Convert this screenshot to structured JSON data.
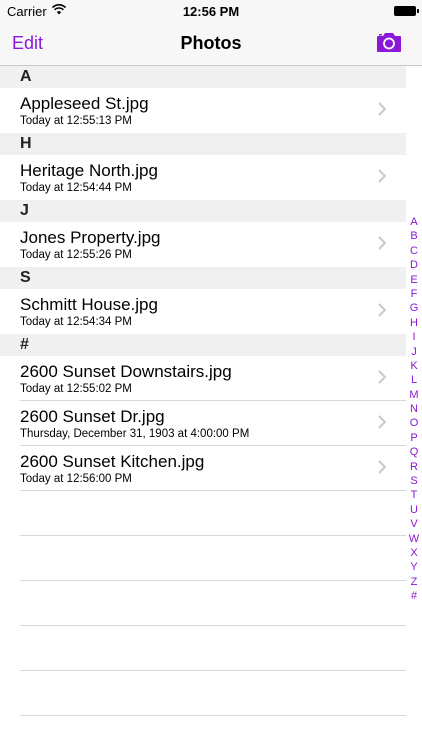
{
  "status_bar": {
    "carrier": "Carrier",
    "time": "12:56 PM"
  },
  "nav": {
    "edit_label": "Edit",
    "title": "Photos",
    "camera_icon": "camera-icon",
    "accent_color": "#8a18d6"
  },
  "sections": [
    {
      "header": "A",
      "rows": [
        {
          "title": "Appleseed St.jpg",
          "subtitle": "Today at 12:55:13 PM"
        }
      ]
    },
    {
      "header": "H",
      "rows": [
        {
          "title": "Heritage North.jpg",
          "subtitle": "Today at 12:54:44 PM"
        }
      ]
    },
    {
      "header": "J",
      "rows": [
        {
          "title": "Jones Property.jpg",
          "subtitle": "Today at 12:55:26 PM"
        }
      ]
    },
    {
      "header": "S",
      "rows": [
        {
          "title": "Schmitt House.jpg",
          "subtitle": "Today at 12:54:34 PM"
        }
      ]
    },
    {
      "header": "#",
      "rows": [
        {
          "title": "2600 Sunset Downstairs.jpg",
          "subtitle": "Today at 12:55:02 PM"
        },
        {
          "title": "2600 Sunset Dr.jpg",
          "subtitle": "Thursday, December 31, 1903 at 4:00:00 PM"
        },
        {
          "title": "2600 Sunset Kitchen.jpg",
          "subtitle": "Today at 12:56:00 PM"
        }
      ]
    }
  ],
  "index_letters": [
    "A",
    "B",
    "C",
    "D",
    "E",
    "F",
    "G",
    "H",
    "I",
    "J",
    "K",
    "L",
    "M",
    "N",
    "O",
    "P",
    "Q",
    "R",
    "S",
    "T",
    "U",
    "V",
    "W",
    "X",
    "Y",
    "Z",
    "#"
  ]
}
